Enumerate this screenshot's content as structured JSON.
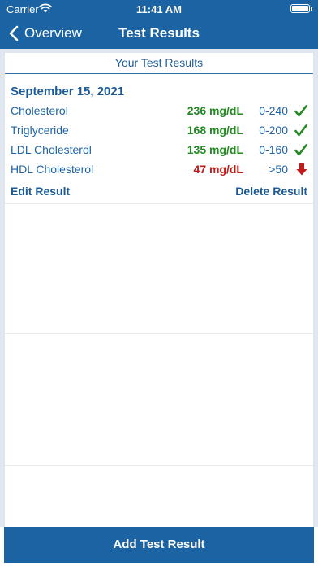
{
  "status_bar": {
    "carrier": "Carrier",
    "time": "11:41 AM"
  },
  "nav": {
    "back_label": "Overview",
    "title": "Test Results"
  },
  "card": {
    "title": "Your Test Results"
  },
  "record": {
    "date": "September 15, 2021",
    "results": [
      {
        "name": "Cholesterol",
        "value": "236 mg/dL",
        "range": "0-240",
        "status": "check-icon"
      },
      {
        "name": "Triglyceride",
        "value": "168 mg/dL",
        "range": "0-200",
        "status": "check-icon"
      },
      {
        "name": "LDL Cholesterol",
        "value": "135 mg/dL",
        "range": "0-160",
        "status": "check-icon"
      },
      {
        "name": "HDL Cholesterol",
        "value": "47 mg/dL",
        "range": ">50",
        "status": "arrow-down-icon"
      }
    ],
    "edit_label": "Edit Result",
    "delete_label": "Delete Result"
  },
  "footer": {
    "add_label": "Add Test Result"
  },
  "colors": {
    "primary": "#1b63a3",
    "normal": "#1f8a1f",
    "low": "#c41a1a",
    "background": "#dfe6ef"
  }
}
